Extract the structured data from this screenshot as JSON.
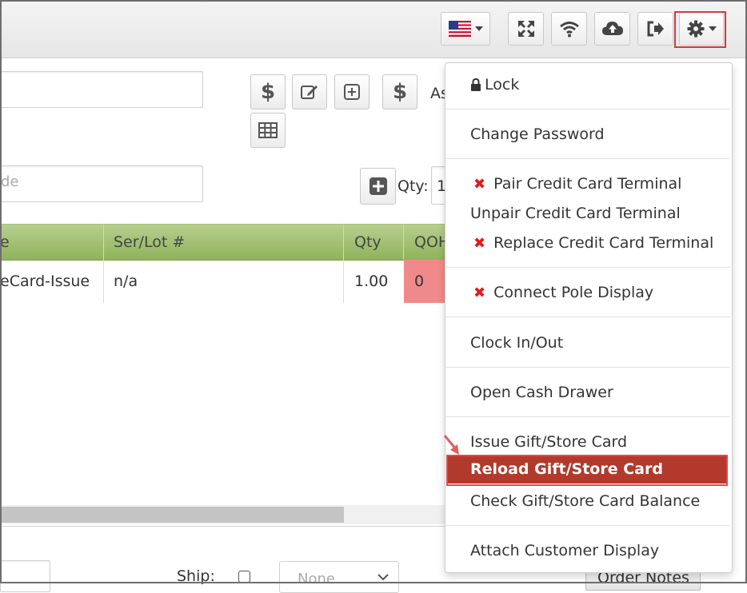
{
  "topbar": {
    "icons": [
      "us-flag-icon",
      "expand-icon",
      "wifi-icon",
      "cloud-upload-icon",
      "logout-icon",
      "gear-icon"
    ]
  },
  "form": {
    "code_placeholder": "de",
    "qty_label": "Qty:",
    "qty_value": "1",
    "assign_label": "As"
  },
  "grid": {
    "columns": [
      "e",
      "Ser/Lot #",
      "Qty",
      "QOH"
    ],
    "rows": [
      {
        "item": "eCard-Issue",
        "serlot": "n/a",
        "qty": "1.00",
        "qoh": "0"
      }
    ]
  },
  "footer": {
    "ship_label": "Ship:",
    "ship_select_value": "None",
    "order_notes_label": "Order Notes"
  },
  "menu": {
    "lock": "Lock",
    "change_password": "Change Password",
    "pair_terminal": "Pair Credit Card Terminal",
    "unpair_terminal": "Unpair Credit Card Terminal",
    "replace_terminal": "Replace Credit Card Terminal",
    "connect_pole": "Connect Pole Display",
    "clock": "Clock In/Out",
    "cash_drawer": "Open Cash Drawer",
    "issue_gift": "Issue Gift/Store Card",
    "reload_gift": "Reload Gift/Store Card",
    "check_gift": "Check Gift/Store Card Balance",
    "attach_display": "Attach Customer Display",
    "status_icon": "red-x-icon"
  },
  "colors": {
    "grid_header": "#9fbd6d",
    "qoh_warning": "#f08a8a",
    "active_item": "#b23a2c",
    "annotation": "#d23b3b"
  }
}
